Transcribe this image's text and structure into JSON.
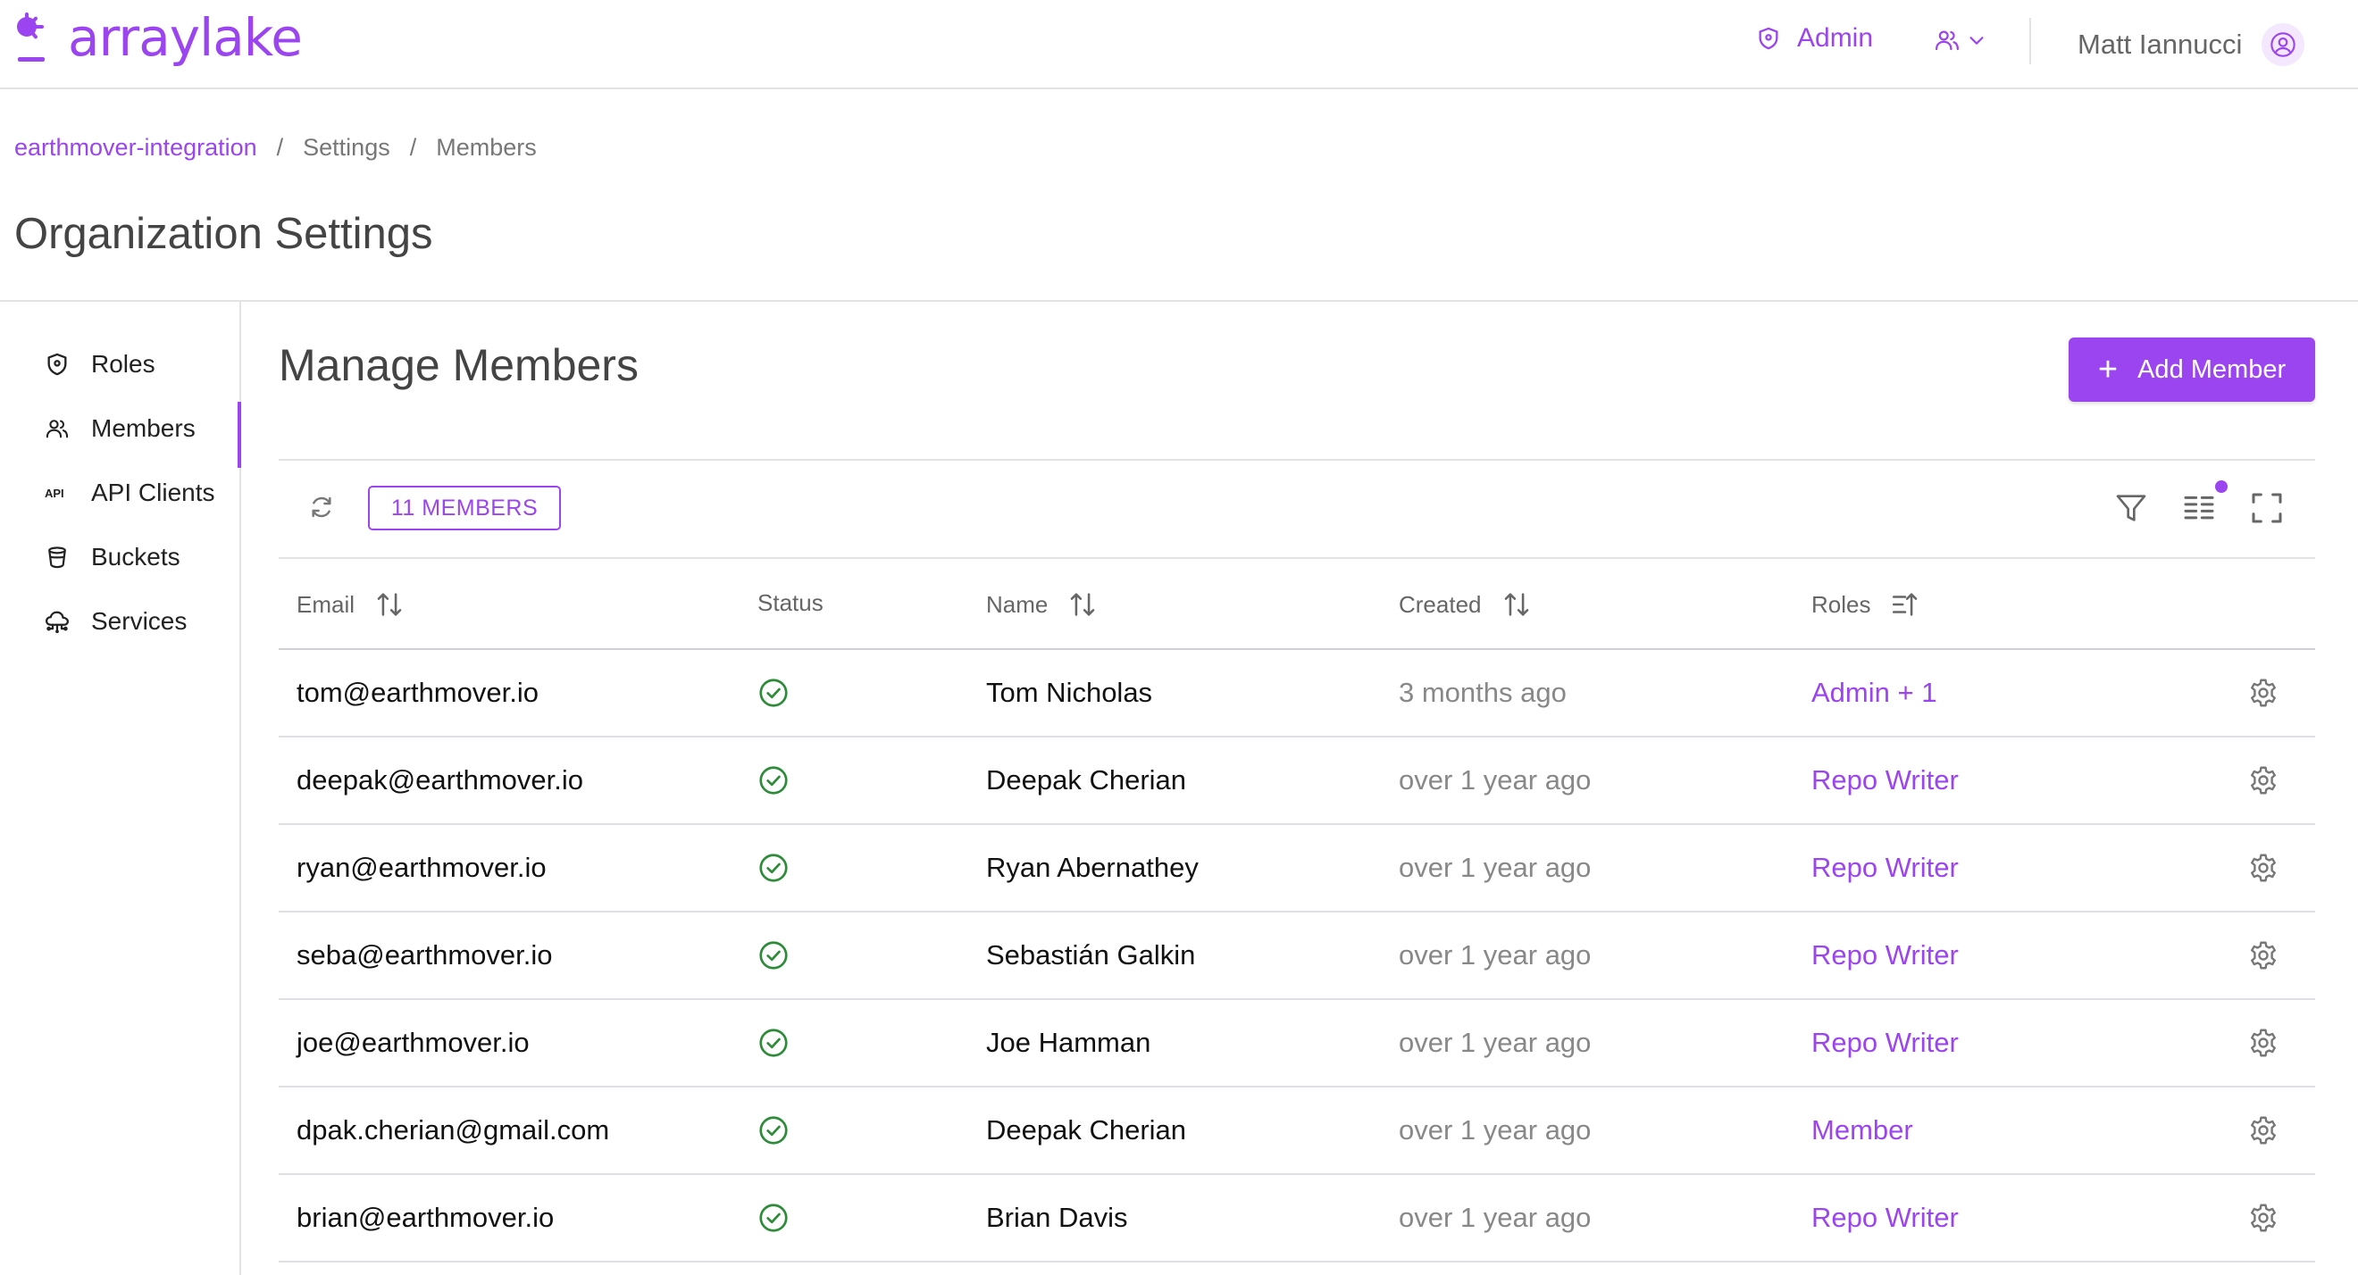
{
  "header": {
    "logo_text": "arraylake",
    "admin_label": "Admin",
    "user_name": "Matt Iannucci",
    "accent_color": "#9b45f0"
  },
  "breadcrumb": [
    "earthmover-integration",
    "Settings",
    "Members"
  ],
  "page_title": "Organization Settings",
  "sidebar": {
    "items": [
      {
        "label": "Roles",
        "icon": "shield-icon"
      },
      {
        "label": "Members",
        "icon": "users-icon",
        "active": true
      },
      {
        "label": "API Clients",
        "icon": "api-icon"
      },
      {
        "label": "Buckets",
        "icon": "bucket-icon"
      },
      {
        "label": "Services",
        "icon": "cloud-service-icon"
      }
    ]
  },
  "main": {
    "title": "Manage Members",
    "add_button_label": "Add Member",
    "member_count_label": "11 MEMBERS"
  },
  "table": {
    "columns": [
      "Email",
      "Status",
      "Name",
      "Created",
      "Roles"
    ],
    "rows": [
      {
        "email": "tom@earthmover.io",
        "status": "active",
        "name": "Tom Nicholas",
        "created": "3 months ago",
        "roles": "Admin + 1"
      },
      {
        "email": "deepak@earthmover.io",
        "status": "active",
        "name": "Deepak Cherian",
        "created": "over 1 year ago",
        "roles": "Repo Writer"
      },
      {
        "email": "ryan@earthmover.io",
        "status": "active",
        "name": "Ryan Abernathey",
        "created": "over 1 year ago",
        "roles": "Repo Writer"
      },
      {
        "email": "seba@earthmover.io",
        "status": "active",
        "name": "Sebastián Galkin",
        "created": "over 1 year ago",
        "roles": "Repo Writer"
      },
      {
        "email": "joe@earthmover.io",
        "status": "active",
        "name": "Joe Hamman",
        "created": "over 1 year ago",
        "roles": "Repo Writer"
      },
      {
        "email": "dpak.cherian@gmail.com",
        "status": "active",
        "name": "Deepak Cherian",
        "created": "over 1 year ago",
        "roles": "Member"
      },
      {
        "email": "brian@earthmover.io",
        "status": "active",
        "name": "Brian Davis",
        "created": "over 1 year ago",
        "roles": "Repo Writer"
      }
    ]
  }
}
